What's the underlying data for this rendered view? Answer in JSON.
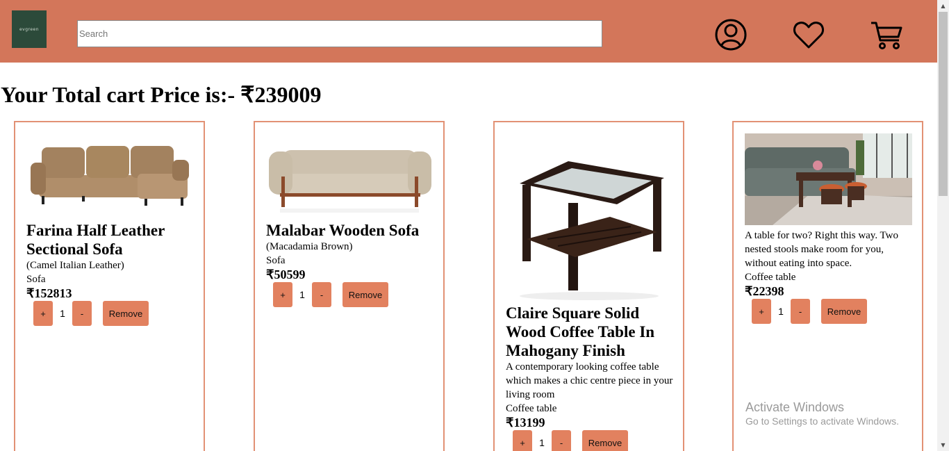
{
  "header": {
    "logo_text": "evgreen",
    "search_placeholder": "Search",
    "search_value": "",
    "icons": [
      "account-icon",
      "wishlist-heart-icon",
      "cart-icon"
    ],
    "bg_color": "#d3765a"
  },
  "cart": {
    "total_label": "Your Total cart Price is:- ₹239009"
  },
  "products": [
    {
      "name": "Farina Half Leather Sectional Sofa",
      "details": [
        "(Camel Italian Leather)"
      ],
      "category": "Sofa",
      "price": "₹152813",
      "qty": "1",
      "image_icon": "sectional-sofa-image"
    },
    {
      "name": "Malabar Wooden Sofa",
      "details": [
        "(Macadamia Brown)"
      ],
      "category": "Sofa",
      "price": "₹50599",
      "qty": "1",
      "image_icon": "wooden-sofa-image"
    },
    {
      "name": "Claire Square Solid Wood Coffee Table In Mahogany Finish",
      "details": [
        "A contemporary looking coffee table which makes a chic centre piece in your living room"
      ],
      "category": "Coffee table",
      "price": "₹13199",
      "qty": "1",
      "image_icon": "coffee-table-image"
    },
    {
      "name": "",
      "details": [
        "A table for two? Right this way. Two nested stools make room for you, without eating into space."
      ],
      "category": "Coffee table",
      "price": "₹22398",
      "qty": "1",
      "image_icon": "living-room-table-image"
    }
  ],
  "controls": {
    "plus_label": "+",
    "minus_label": "-",
    "remove_label": "Remove"
  },
  "watermark": {
    "title": "Activate Windows",
    "subtitle": "Go to Settings to activate Windows."
  },
  "colors": {
    "accent": "#e2815f",
    "card_border": "#e29174"
  }
}
